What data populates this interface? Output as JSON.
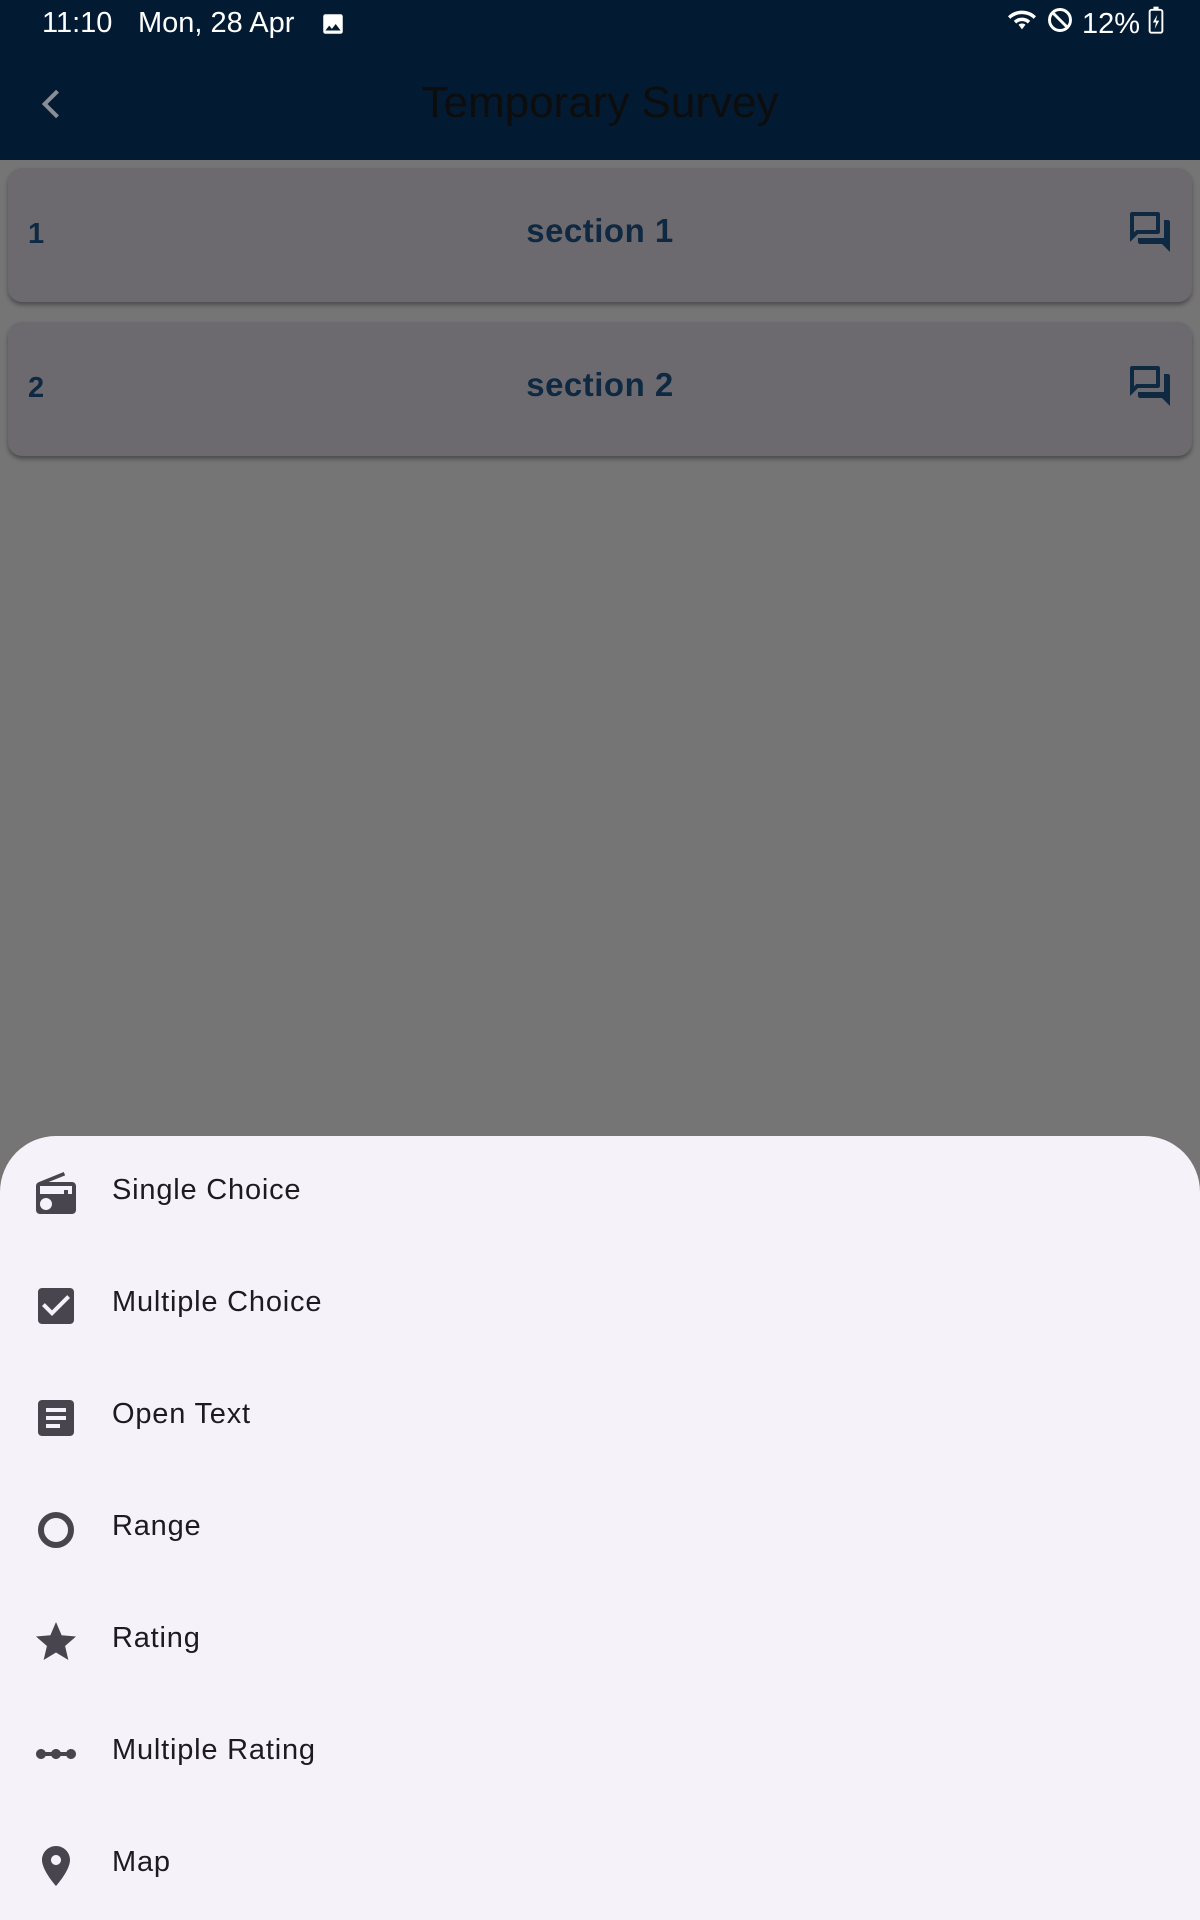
{
  "status_bar": {
    "time": "11:10",
    "date": "Mon, 28 Apr",
    "battery": "12%"
  },
  "app_bar": {
    "title": "Temporary Survey",
    "back_icon": "chevron-left-icon"
  },
  "sections": [
    {
      "number": "1",
      "label": "section 1",
      "icon": "chat-icon"
    },
    {
      "number": "2",
      "label": "section 2",
      "icon": "chat-icon"
    }
  ],
  "sheet": {
    "items": [
      {
        "label": "Single Choice",
        "icon": "radio-icon"
      },
      {
        "label": "Multiple Choice",
        "icon": "checkbox-icon"
      },
      {
        "label": "Open Text",
        "icon": "article-icon"
      },
      {
        "label": "Range",
        "icon": "circle-icon"
      },
      {
        "label": "Rating",
        "icon": "star-icon"
      },
      {
        "label": "Multiple Rating",
        "icon": "linear-scale-icon"
      },
      {
        "label": "Map",
        "icon": "location-pin-icon"
      }
    ]
  },
  "colors": {
    "app_bar": "#021b33",
    "scrim": "#757575",
    "card": "#6c6a6f",
    "card_text": "#0f2942",
    "sheet": "#f6f2f9",
    "icon": "#49454f"
  }
}
